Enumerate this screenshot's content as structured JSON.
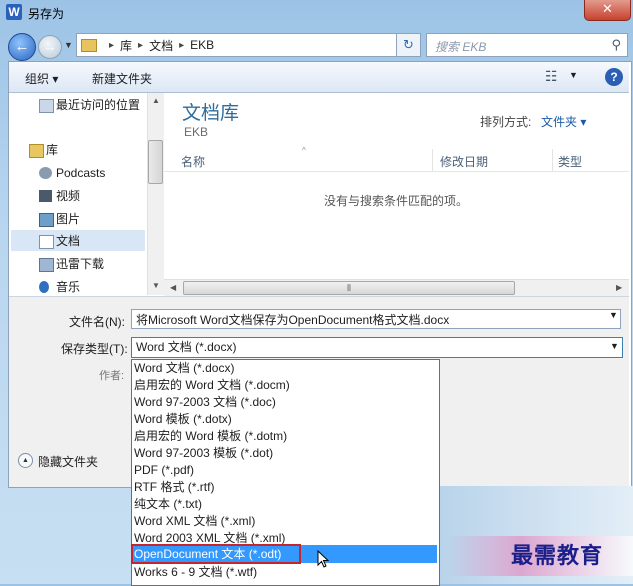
{
  "window": {
    "title": "另存为",
    "app_icon": "W"
  },
  "nav": {
    "breadcrumb": [
      "库",
      "文档",
      "EKB"
    ],
    "search_placeholder": "搜索 EKB"
  },
  "toolbar": {
    "organize": "组织 ▾",
    "new_folder": "新建文件夹"
  },
  "sidebar": {
    "items": [
      {
        "label": "最近访问的位置",
        "icon": "recent-places-icon"
      },
      {
        "label": "库",
        "icon": "library-icon"
      },
      {
        "label": "Podcasts",
        "icon": "podcast-icon"
      },
      {
        "label": "视频",
        "icon": "video-icon"
      },
      {
        "label": "图片",
        "icon": "pictures-icon"
      },
      {
        "label": "文档",
        "icon": "documents-icon",
        "selected": true
      },
      {
        "label": "迅雷下载",
        "icon": "thunder-download-icon"
      },
      {
        "label": "音乐",
        "icon": "music-icon"
      }
    ]
  },
  "content": {
    "library_title": "文档库",
    "library_subtitle": "EKB",
    "arrange_label": "排列方式:",
    "arrange_value": "文件夹 ▾",
    "columns": [
      "名称",
      "修改日期",
      "类型"
    ],
    "empty_message": "没有与搜索条件匹配的项。"
  },
  "form": {
    "filename_label": "文件名(N):",
    "filename_value": "将Microsoft Word文档保存为OpenDocument格式文档.docx",
    "type_label": "保存类型(T):",
    "type_value": "Word 文档 (*.docx)",
    "author_label": "作者:",
    "hide_folders": "隐藏文件夹"
  },
  "type_options": [
    "Word 文档 (*.docx)",
    "启用宏的 Word 文档 (*.docm)",
    "Word 97-2003 文档 (*.doc)",
    "Word 模板 (*.dotx)",
    "启用宏的 Word 模板 (*.dotm)",
    "Word 97-2003 模板 (*.dot)",
    "PDF (*.pdf)",
    "RTF 格式 (*.rtf)",
    "纯文本 (*.txt)",
    "Word XML 文档 (*.xml)",
    "Word 2003 XML 文档 (*.xml)",
    "OpenDocument 文本 (*.odt)",
    "Works 6 - 9 文档 (*.wtf)"
  ],
  "highlighted_option": "OpenDocument 文本 (*.odt)",
  "watermark": "最需教育",
  "colors": {
    "highlight": "#3399ff",
    "annotation_box": "#c6252c",
    "library_title": "#2e6c9e"
  }
}
